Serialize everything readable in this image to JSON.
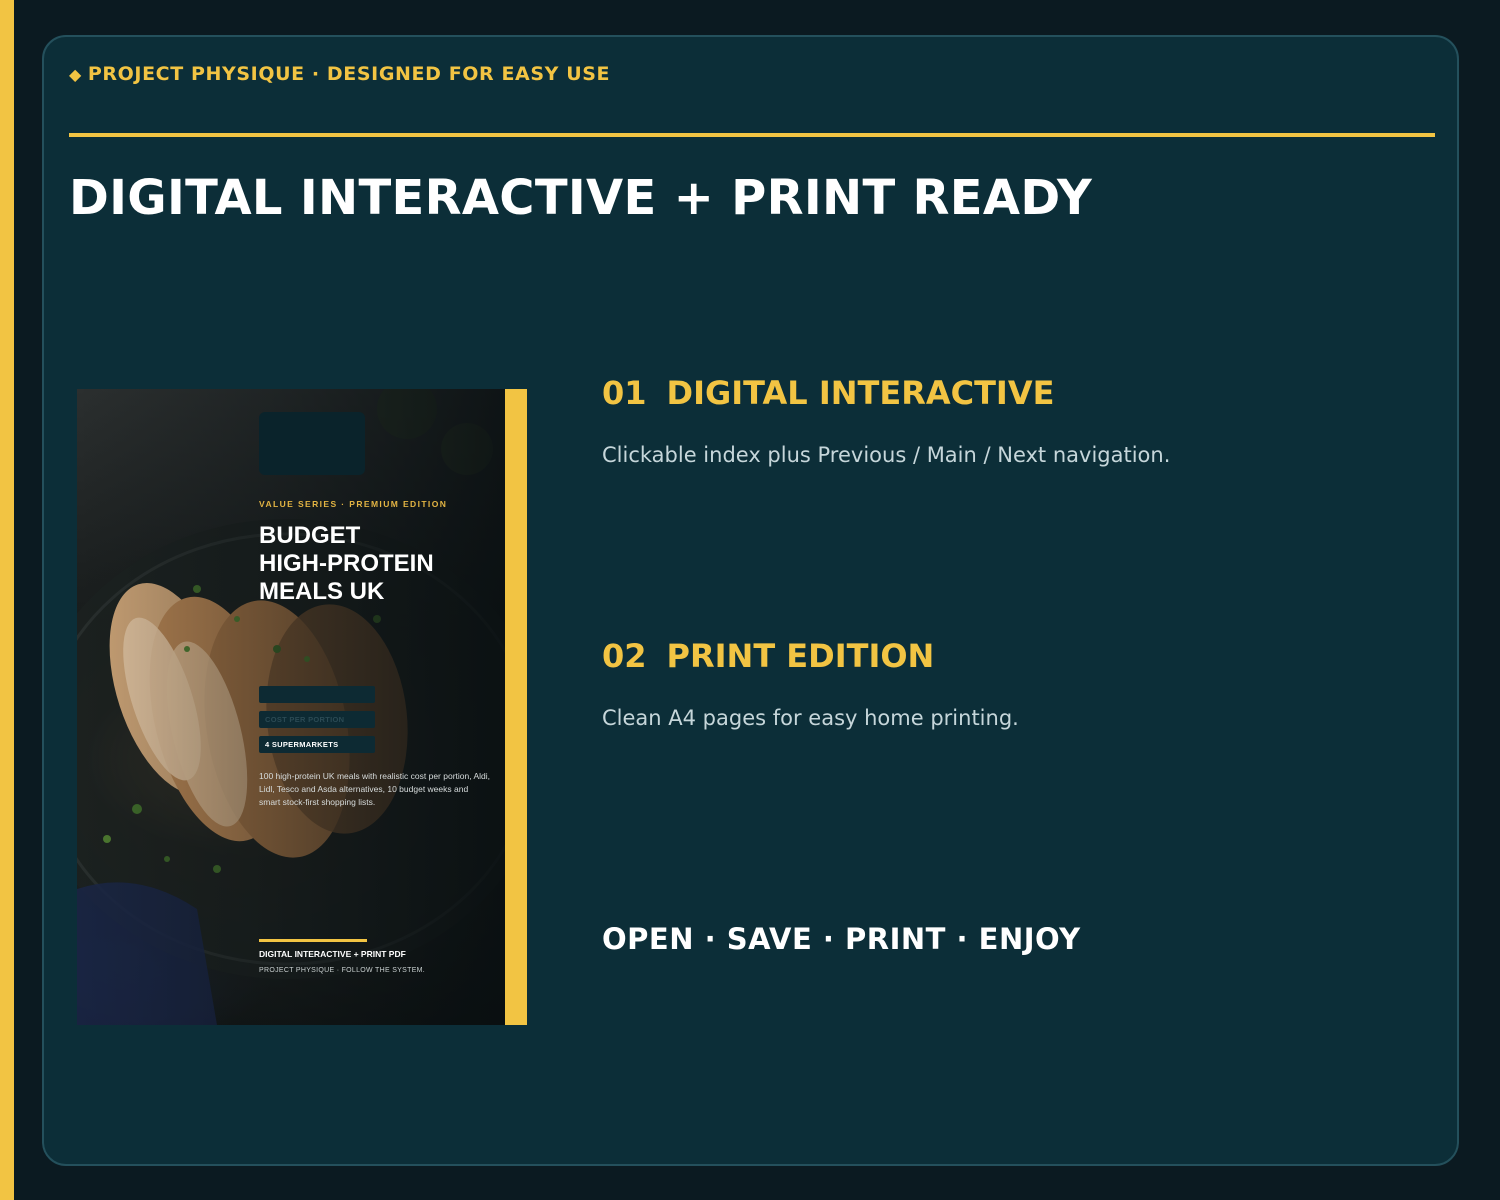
{
  "eyebrow": {
    "icon": "diamond-icon",
    "text": "PROJECT PHYSIQUE · DESIGNED FOR EASY USE"
  },
  "page_title": "DIGITAL INTERACTIVE + PRINT READY",
  "cover": {
    "series": "VALUE SERIES · PREMIUM EDITION",
    "title_lines": [
      "BUDGET",
      "HIGH-PROTEIN",
      "MEALS UK"
    ],
    "chips": [
      "",
      "COST PER PORTION",
      "4 SUPERMARKETS"
    ],
    "description": "100 high-protein UK meals with realistic cost per portion, Aldi, Lidl, Tesco and Asda alternatives, 10 budget weeks and smart stock-first shopping lists.",
    "format": "DIGITAL INTERACTIVE + PRINT PDF",
    "brand": "PROJECT PHYSIQUE  ·  FOLLOW THE SYSTEM."
  },
  "features": [
    {
      "number": "01",
      "title": "DIGITAL INTERACTIVE",
      "text": "Clickable index plus Previous / Main / Next navigation."
    },
    {
      "number": "02",
      "title": "PRINT EDITION",
      "text": "Clean A4 pages for easy home printing."
    }
  ],
  "tagline": "OPEN · SAVE · PRINT · ENJOY",
  "colors": {
    "background": "#0b1a21",
    "card": "#0c2e38",
    "accent": "#f2c443",
    "text": "#ffffff",
    "muted_text": "#c6d6da"
  }
}
